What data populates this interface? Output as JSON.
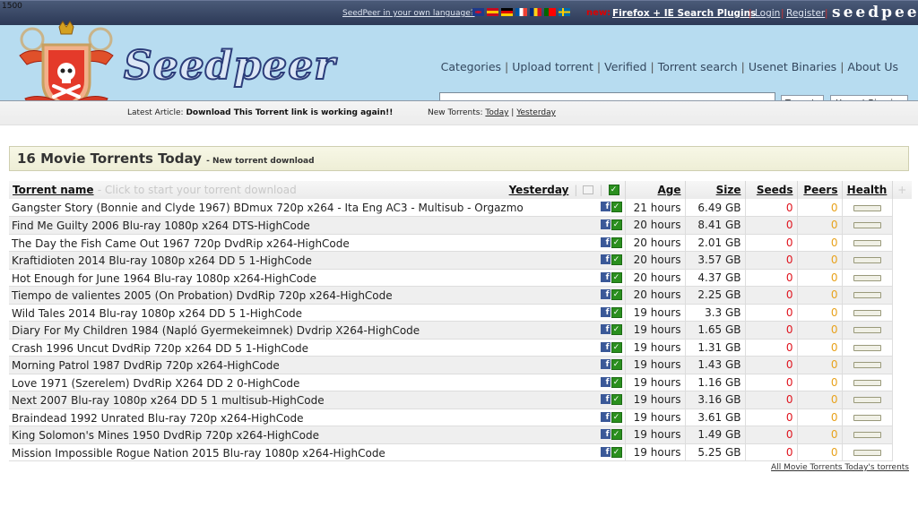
{
  "topbar": {
    "counter": "1500",
    "language_link": "SeedPeer in your own language?",
    "flags": [
      {
        "name": "uk-flag",
        "colors": [
          "#1f3a8a",
          "#c8102e",
          "#ffffff"
        ]
      },
      {
        "name": "spain-flag",
        "colors": [
          "#c60b1e",
          "#ffc400",
          "#c60b1e"
        ]
      },
      {
        "name": "germany-flag",
        "colors": [
          "#000000",
          "#dd0000",
          "#ffce00"
        ]
      },
      {
        "name": "france-flag",
        "colors": [
          "#0055a4",
          "#ffffff",
          "#ef4135"
        ]
      },
      {
        "name": "romania-flag",
        "colors": [
          "#002b7f",
          "#fcd116",
          "#ce1126"
        ]
      },
      {
        "name": "portugal-flag",
        "colors": [
          "#006600",
          "#ff0000",
          "#ff0000"
        ]
      },
      {
        "name": "sweden-flag",
        "colors": [
          "#006aa7",
          "#fecc00",
          "#006aa7"
        ]
      }
    ],
    "new_label": "new:",
    "plugins_link": "Firefox + IE Search Plugins",
    "login": "Login",
    "register": "Register",
    "brand": "seedpeer",
    "separator": "|"
  },
  "header": {
    "logo_text": "Seedpeer",
    "nav": [
      "Categories",
      "Upload torrent",
      "Verified",
      "Torrent search",
      "Usenet Binaries",
      "About Us"
    ],
    "search": {
      "value": "",
      "placeholder": ""
    },
    "buttons": {
      "torrents": "Torrents",
      "usenet": "Usenet Binaries"
    }
  },
  "subbar": {
    "latest_label": "Latest Article:",
    "latest_title": "Download This Torrent link is working again!!",
    "new_torrents_label": "New Torrents:",
    "today": "Today",
    "yesterday": "Yesterday",
    "separator": "|"
  },
  "section": {
    "title": "16 Movie Torrents Today",
    "subtitle": "- New torrent download"
  },
  "table": {
    "headers": {
      "name": "Torrent name",
      "hint": "- Click to start your torrent download",
      "yesterday": "Yesterday",
      "age": "Age",
      "size": "Size",
      "seeds": "Seeds",
      "peers": "Peers",
      "health": "Health",
      "plus": "+"
    },
    "rows": [
      {
        "name": "Gangster Story (Bonnie and Clyde 1967) BDmux 720p x264 - Ita Eng AC3 - Multisub - Orgazmo",
        "age": "21 hours",
        "size": "6.49 GB",
        "seeds": "0",
        "peers": "0",
        "health": 0
      },
      {
        "name": "Find Me Guilty 2006 Blu-ray 1080p x264 DTS-HighCode",
        "age": "20 hours",
        "size": "8.41 GB",
        "seeds": "0",
        "peers": "0",
        "health": 0
      },
      {
        "name": "The Day the Fish Came Out 1967 720p DvdRip x264-HighCode",
        "age": "20 hours",
        "size": "2.01 GB",
        "seeds": "0",
        "peers": "0",
        "health": 0
      },
      {
        "name": "Kraftidioten 2014 Blu-ray 1080p x264 DD 5 1-HighCode",
        "age": "20 hours",
        "size": "3.57 GB",
        "seeds": "0",
        "peers": "0",
        "health": 0
      },
      {
        "name": "Hot Enough for June 1964 Blu-ray 1080p x264-HighCode",
        "age": "20 hours",
        "size": "4.37 GB",
        "seeds": "0",
        "peers": "0",
        "health": 0
      },
      {
        "name": "Tiempo de valientes 2005 (On Probation) DvdRip 720p x264-HighCode",
        "age": "20 hours",
        "size": "2.25 GB",
        "seeds": "0",
        "peers": "0",
        "health": 0
      },
      {
        "name": "Wild Tales 2014 Blu-ray 1080p x264 DD 5 1-HighCode",
        "age": "19 hours",
        "size": "3.3 GB",
        "seeds": "0",
        "peers": "0",
        "health": 0
      },
      {
        "name": "Diary For My Children 1984 (Napló Gyermekeimnek) Dvdrip X264-HighCode",
        "age": "19 hours",
        "size": "1.65 GB",
        "seeds": "0",
        "peers": "0",
        "health": 0
      },
      {
        "name": "Crash 1996 Uncut DvdRip 720p x264 DD 5 1-HighCode",
        "age": "19 hours",
        "size": "1.31 GB",
        "seeds": "0",
        "peers": "0",
        "health": 0
      },
      {
        "name": "Morning Patrol 1987 DvdRip 720p x264-HighCode",
        "age": "19 hours",
        "size": "1.43 GB",
        "seeds": "0",
        "peers": "0",
        "health": 0
      },
      {
        "name": "Love 1971 (Szerelem) DvdRip X264 DD 2 0-HighCode",
        "age": "19 hours",
        "size": "1.16 GB",
        "seeds": "0",
        "peers": "0",
        "health": 0
      },
      {
        "name": "Next 2007 Blu-ray 1080p x264 DD 5 1 multisub-HighCode",
        "age": "19 hours",
        "size": "3.16 GB",
        "seeds": "0",
        "peers": "0",
        "health": 0
      },
      {
        "name": "Braindead 1992 Unrated Blu-ray 720p x264-HighCode",
        "age": "19 hours",
        "size": "3.61 GB",
        "seeds": "0",
        "peers": "0",
        "health": 0
      },
      {
        "name": "King Solomon's Mines 1950 DvdRip 720p x264-HighCode",
        "age": "19 hours",
        "size": "1.49 GB",
        "seeds": "0",
        "peers": "0",
        "health": 0
      },
      {
        "name": "Mission Impossible Rogue Nation 2015 Blu-ray 1080p x264-HighCode",
        "age": "19 hours",
        "size": "5.25 GB",
        "seeds": "0",
        "peers": "0",
        "health": 0
      }
    ]
  },
  "footer": {
    "all_link": "All Movie Torrents Today's torrents"
  },
  "colors": {
    "seeds": "#e0141e",
    "peers": "#e8a21c",
    "verified": "#2a8f1e",
    "facebook": "#3b5998",
    "header_bg": "#b7dcf0",
    "topbar_bg": "#2c3956"
  }
}
